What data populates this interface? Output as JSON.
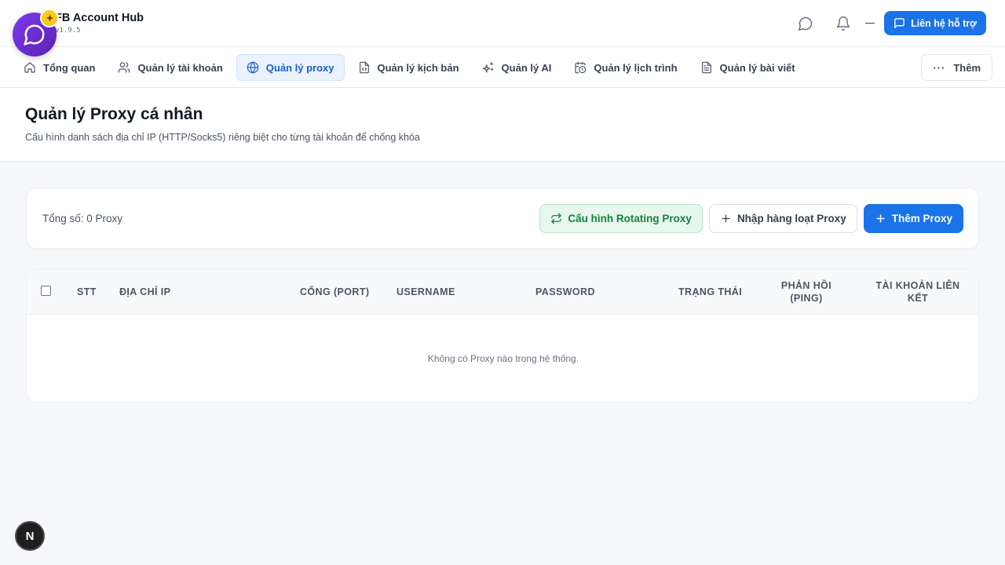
{
  "app": {
    "title": "FB Account Hub",
    "version": "v1.9.5"
  },
  "header": {
    "support_label": "Liên hệ hỗ trợ"
  },
  "nav": {
    "items": [
      {
        "label": "Tổng quan",
        "icon": "home-icon"
      },
      {
        "label": "Quản lý tài khoản",
        "icon": "users-icon"
      },
      {
        "label": "Quản lý proxy",
        "icon": "globe-icon",
        "active": true
      },
      {
        "label": "Quản lý kịch bản",
        "icon": "file-code-icon"
      },
      {
        "label": "Quản lý AI",
        "icon": "sparkles-icon"
      },
      {
        "label": "Quản lý lịch trình",
        "icon": "calendar-clock-icon"
      },
      {
        "label": "Quản lý bài viết",
        "icon": "file-text-icon"
      }
    ],
    "more_label": "Thêm"
  },
  "page": {
    "title": "Quản lý Proxy cá nhân",
    "subtitle": "Cấu hình danh sách địa chỉ IP (HTTP/Socks5) riêng biệt cho từng tài khoản để chống khóa"
  },
  "toolbar": {
    "total_text": "Tổng số: 0 Proxy",
    "rotate_label": "Cấu hình Rotating Proxy",
    "import_label": "Nhập hàng loạt Proxy",
    "add_label": "Thêm Proxy"
  },
  "table": {
    "columns": {
      "stt": "STT",
      "ip": "Địa chỉ IP",
      "port": "Cổng (Port)",
      "username": "Username",
      "password": "Password",
      "status": "Trạng thái",
      "ping": "Phản hồi (Ping)",
      "accounts": "Tài khoản liên kết"
    },
    "empty_text": "Không có Proxy nào trong hệ thống."
  },
  "fab": {
    "n_label": "N"
  },
  "colors": {
    "primary": "#1a73e8",
    "success": "#15803d",
    "fab": "#6d28d9"
  }
}
